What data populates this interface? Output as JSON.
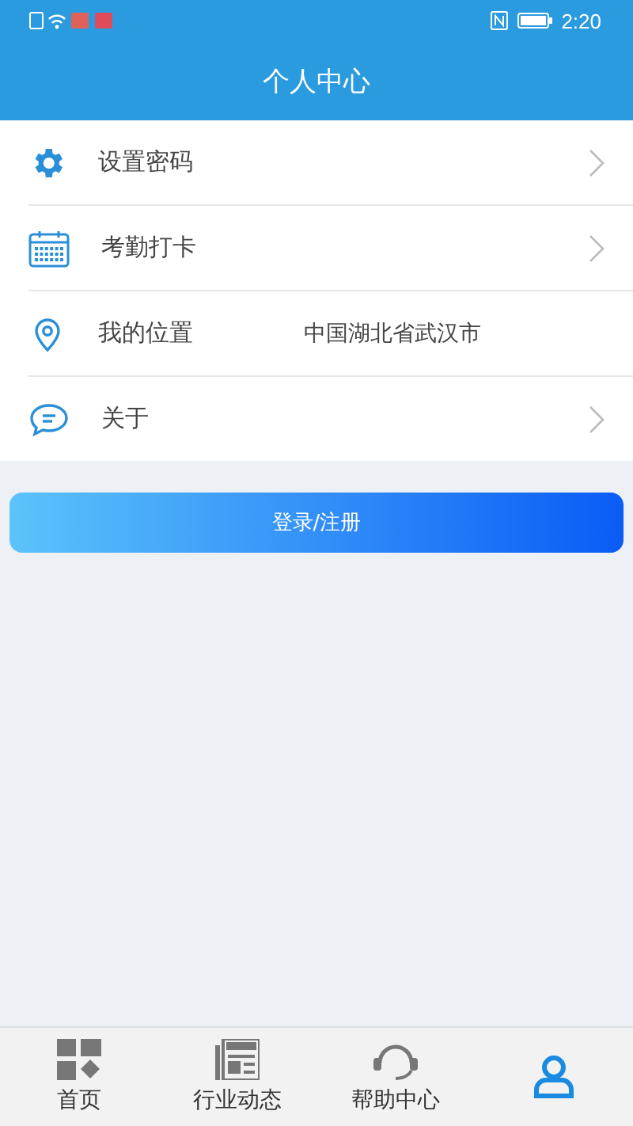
{
  "status_bar": {
    "time": "2:20"
  },
  "header": {
    "title": "个人中心"
  },
  "menu": [
    {
      "kind": "gear",
      "label": "设置密码",
      "chevron": true
    },
    {
      "kind": "calendar",
      "label": "考勤打卡",
      "chevron": true
    },
    {
      "kind": "pin",
      "label": "我的位置",
      "value": "中国湖北省武汉市",
      "chevron": false
    },
    {
      "kind": "chat",
      "label": "关于",
      "chevron": true
    }
  ],
  "login_button": {
    "label": "登录/注册"
  },
  "tab_bar": [
    {
      "kind": "home",
      "label": "首页",
      "selected": false
    },
    {
      "kind": "news",
      "label": "行业动态",
      "selected": false
    },
    {
      "kind": "help",
      "label": "帮助中心",
      "selected": false
    },
    {
      "kind": "user",
      "selected": true
    }
  ]
}
